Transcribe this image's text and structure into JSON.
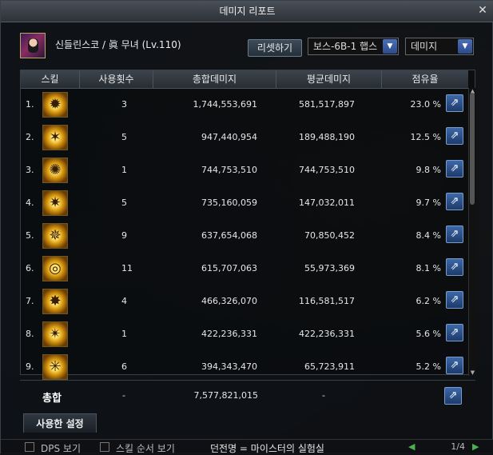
{
  "window": {
    "title": "데미지 리포트",
    "close_icon": "close-icon"
  },
  "character": {
    "name": "신들린스코 / 眞 무녀 (Lv.110)"
  },
  "controls": {
    "reset_label": "리셋하기",
    "boss_select": "보스-6B-1 햅스",
    "type_select": "데미지"
  },
  "table": {
    "headers": [
      "스킬",
      "사용횟수",
      "총합데미지",
      "평균데미지",
      "점유율"
    ],
    "rows": [
      {
        "rank": "1.",
        "uses": "3",
        "total": "1,744,553,691",
        "avg": "581,517,897",
        "share": "23.0 %"
      },
      {
        "rank": "2.",
        "uses": "5",
        "total": "947,440,954",
        "avg": "189,488,190",
        "share": "12.5 %"
      },
      {
        "rank": "3.",
        "uses": "1",
        "total": "744,753,510",
        "avg": "744,753,510",
        "share": "9.8 %"
      },
      {
        "rank": "4.",
        "uses": "5",
        "total": "735,160,059",
        "avg": "147,032,011",
        "share": "9.7 %"
      },
      {
        "rank": "5.",
        "uses": "9",
        "total": "637,654,068",
        "avg": "70,850,452",
        "share": "8.4 %"
      },
      {
        "rank": "6.",
        "uses": "11",
        "total": "615,707,063",
        "avg": "55,973,369",
        "share": "8.1 %"
      },
      {
        "rank": "7.",
        "uses": "4",
        "total": "466,326,070",
        "avg": "116,581,517",
        "share": "6.2 %"
      },
      {
        "rank": "8.",
        "uses": "1",
        "total": "422,236,331",
        "avg": "422,236,331",
        "share": "5.6 %"
      },
      {
        "rank": "9.",
        "uses": "6",
        "total": "394,343,470",
        "avg": "65,723,911",
        "share": "5.2 %"
      }
    ]
  },
  "total": {
    "label": "총합",
    "uses": "-",
    "total": "7,577,821,015",
    "avg": "-"
  },
  "tab_label": "사용한 설정",
  "footer": {
    "dps_label": "DPS 보기",
    "order_label": "스킬 순서 보기",
    "center_text": "던전명 = 마이스터의 실험실",
    "page": "1/4"
  }
}
